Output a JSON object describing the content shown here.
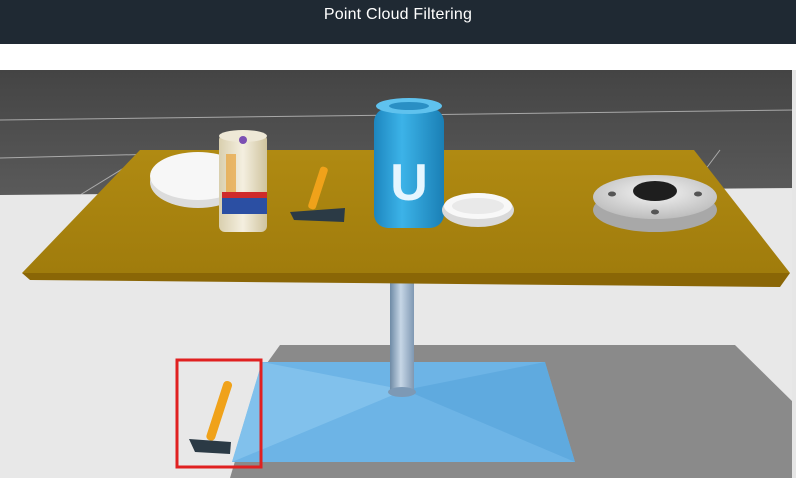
{
  "window": {
    "title": "Point Cloud Filtering"
  },
  "scene": {
    "objects": [
      "table",
      "white-plate",
      "sugar-box",
      "hammer",
      "soda-can",
      "white-bowl",
      "flange-disk",
      "fallen-hammer"
    ],
    "can_logo_glyph": "U",
    "colors": {
      "sky": "#4b4b4b",
      "floor": "#e9e9e9",
      "tabletop": "#b88a10",
      "table_edge": "#8d6a06",
      "pedestal": "#9bb4cc",
      "base_plate": "#6fb7e8",
      "can": "#2a9fd6",
      "hammer_handle": "#f0a21a",
      "hammer_head": "#2b3a45",
      "highlight": "#e02020"
    },
    "highlight_target": "fallen-hammer"
  }
}
